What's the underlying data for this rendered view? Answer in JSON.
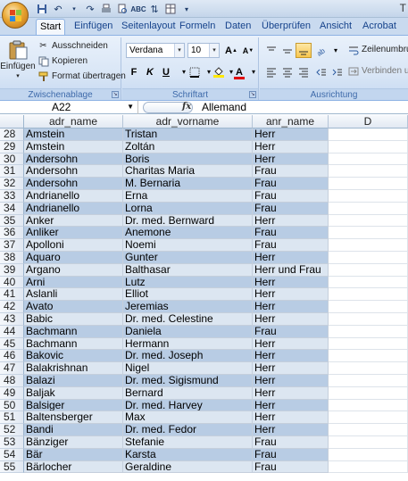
{
  "title_bar": {
    "right_letter": "T"
  },
  "tabs": [
    "Start",
    "Einfügen",
    "Seitenlayout",
    "Formeln",
    "Daten",
    "Überprüfen",
    "Ansicht",
    "Acrobat"
  ],
  "ribbon": {
    "clipboard": {
      "paste_label": "Einfügen",
      "cut_label": "Ausschneiden",
      "copy_label": "Kopieren",
      "format_painter_label": "Format übertragen",
      "group_label": "Zwischenablage"
    },
    "font": {
      "font_name": "Verdana",
      "font_size": "10",
      "bold": "F",
      "italic": "K",
      "underline": "U",
      "group_label": "Schriftart"
    },
    "alignment": {
      "wrap_label": "Zeilenumbruch",
      "merge_label": "Verbinden und",
      "group_label": "Ausrichtung"
    }
  },
  "formula_bar": {
    "name_box": "A22",
    "fx": "fx",
    "value": "Allemand"
  },
  "columns": [
    "adr_name",
    "adr_vorname",
    "anr_name",
    "D"
  ],
  "rows": [
    {
      "num": "28",
      "name": "Amstein",
      "vorname": "Tristan",
      "anrede": "Herr"
    },
    {
      "num": "29",
      "name": "Amstein",
      "vorname": "Zoltán",
      "anrede": "Herr"
    },
    {
      "num": "30",
      "name": "Andersohn",
      "vorname": "Boris",
      "anrede": "Herr"
    },
    {
      "num": "31",
      "name": "Andersohn",
      "vorname": "Charitas Maria",
      "anrede": "Frau"
    },
    {
      "num": "32",
      "name": "Andersohn",
      "vorname": "M. Bernaria",
      "anrede": "Frau"
    },
    {
      "num": "33",
      "name": "Andrianello",
      "vorname": "Erna",
      "anrede": "Frau"
    },
    {
      "num": "34",
      "name": "Andrianello",
      "vorname": "Lorna",
      "anrede": "Frau"
    },
    {
      "num": "35",
      "name": "Anker",
      "vorname": "Dr. med. Bernward",
      "anrede": "Herr"
    },
    {
      "num": "36",
      "name": "Anliker",
      "vorname": "Anemone",
      "anrede": "Frau"
    },
    {
      "num": "37",
      "name": "Apolloni",
      "vorname": "Noemi",
      "anrede": "Frau"
    },
    {
      "num": "38",
      "name": "Aquaro",
      "vorname": "Gunter",
      "anrede": "Herr"
    },
    {
      "num": "39",
      "name": "Argano",
      "vorname": "Balthasar",
      "anrede": "Herr und Frau"
    },
    {
      "num": "40",
      "name": "Arni",
      "vorname": "Lutz",
      "anrede": "Herr"
    },
    {
      "num": "41",
      "name": "Aslanli",
      "vorname": "Elliot",
      "anrede": "Herr"
    },
    {
      "num": "42",
      "name": "Avato",
      "vorname": "Jeremias",
      "anrede": "Herr"
    },
    {
      "num": "43",
      "name": "Babic",
      "vorname": "Dr. med. Celestine",
      "anrede": "Herr"
    },
    {
      "num": "44",
      "name": "Bachmann",
      "vorname": "Daniela",
      "anrede": "Frau"
    },
    {
      "num": "45",
      "name": "Bachmann",
      "vorname": "Hermann",
      "anrede": "Herr"
    },
    {
      "num": "46",
      "name": "Bakovic",
      "vorname": "Dr. med. Joseph",
      "anrede": "Herr"
    },
    {
      "num": "47",
      "name": "Balakrishnan",
      "vorname": "Nigel",
      "anrede": "Herr"
    },
    {
      "num": "48",
      "name": "Balazi",
      "vorname": "Dr. med. Sigismund",
      "anrede": "Herr"
    },
    {
      "num": "49",
      "name": "Baljak",
      "vorname": "Bernard",
      "anrede": "Herr"
    },
    {
      "num": "50",
      "name": "Balsiger",
      "vorname": "Dr. med. Harvey",
      "anrede": "Herr"
    },
    {
      "num": "51",
      "name": "Baltensberger",
      "vorname": "Max",
      "anrede": "Herr"
    },
    {
      "num": "52",
      "name": "Bandi",
      "vorname": "Dr. med. Fedor",
      "anrede": "Herr"
    },
    {
      "num": "53",
      "name": "Bänziger",
      "vorname": "Stefanie",
      "anrede": "Frau"
    },
    {
      "num": "54",
      "name": "Bär",
      "vorname": "Karsta",
      "anrede": "Frau"
    },
    {
      "num": "55",
      "name": "Bärlocher",
      "vorname": "Geraldine",
      "anrede": "Frau"
    }
  ],
  "colors": {
    "band_dark": "#b8cce4",
    "band_light": "#dce6f1",
    "ribbon": "#dbe7f6",
    "highlight": "#f8c64e"
  }
}
